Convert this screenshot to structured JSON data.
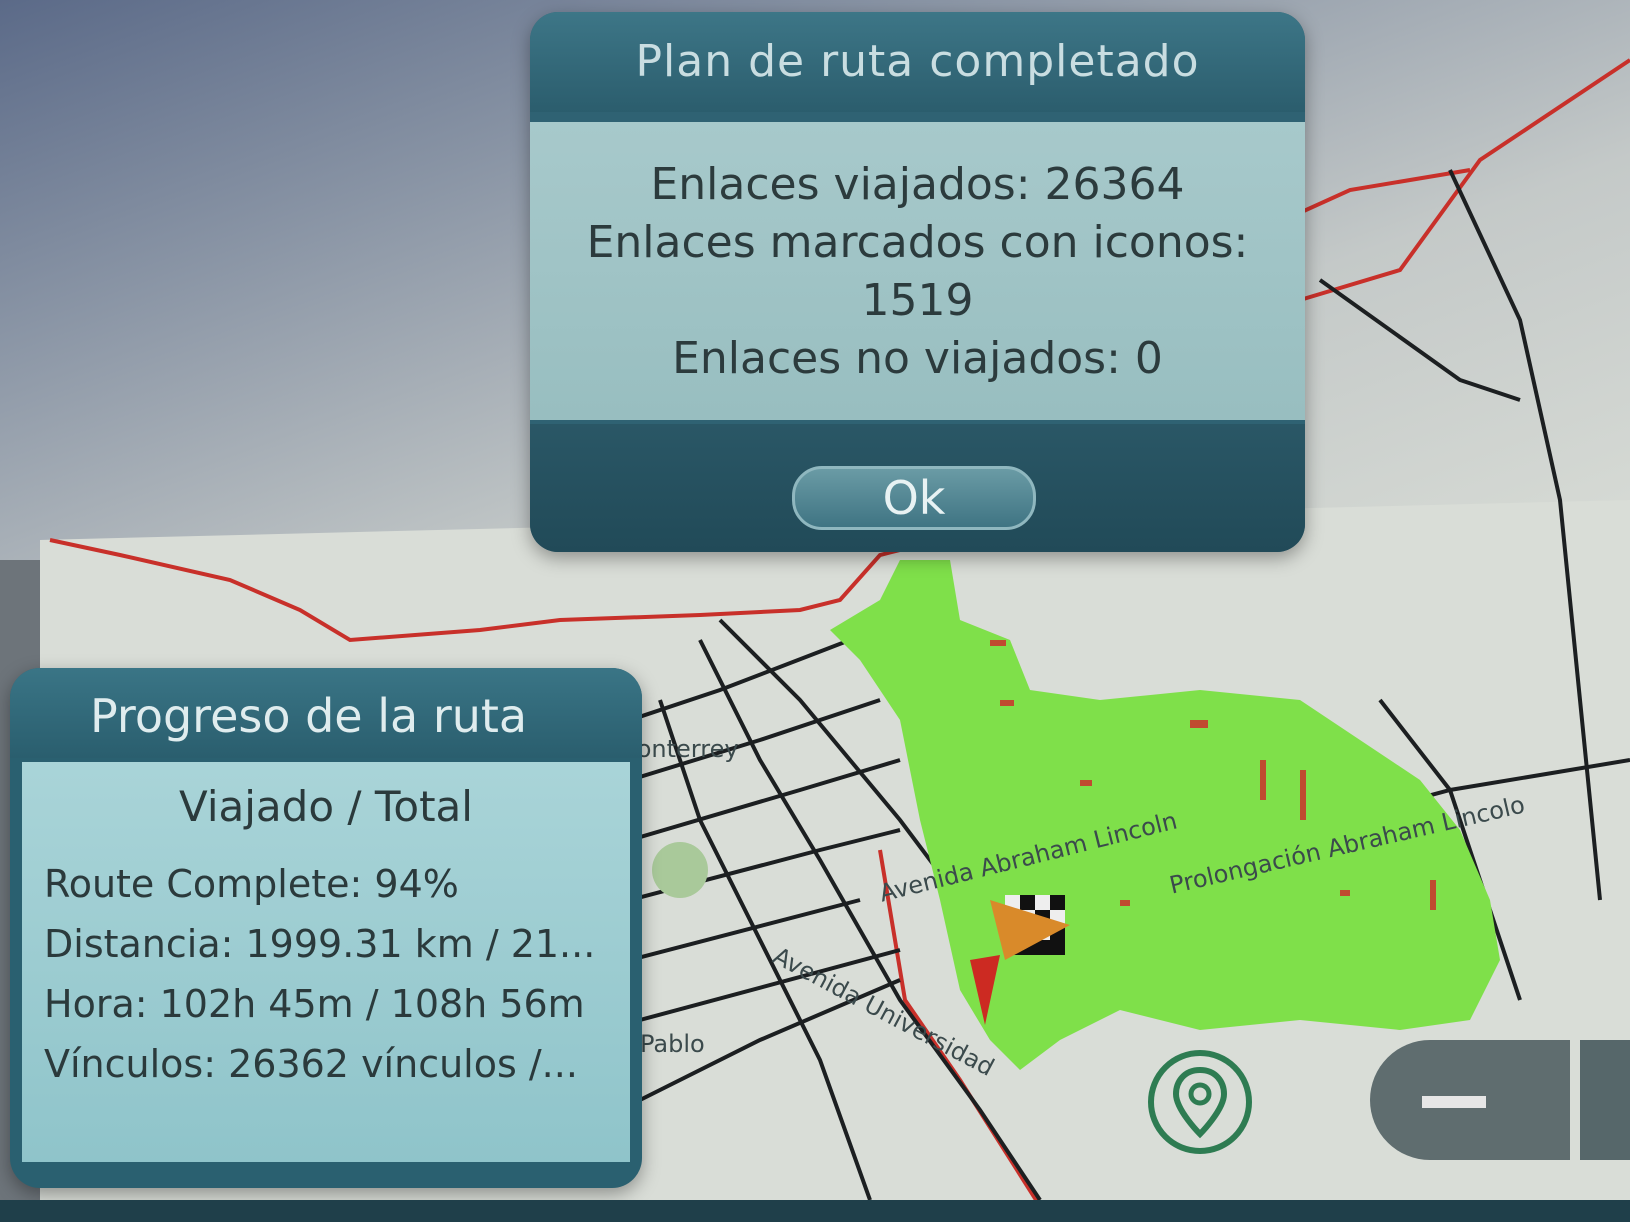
{
  "route_complete_dialog": {
    "title": "Plan de ruta completado",
    "lines": [
      "Enlaces viajados: 26364",
      "Enlaces marcados con iconos:",
      "1519",
      "Enlaces no viajados: 0"
    ],
    "ok_label": "Ok"
  },
  "progress_panel": {
    "title": "Progreso de la ruta",
    "header": "Viajado / Total",
    "route_complete": "Route Complete: 94%",
    "distance": "Distancia: 1999.31 km / 21...",
    "time": "Hora: 102h 45m / 108h 56m",
    "links": "Vínculos: 26362 vínculos /..."
  },
  "map": {
    "labels": {
      "monterrey": "Monterrey",
      "avenida_abraham_lincoln": "Avenida Abraham Lincoln",
      "prolongacion_abraham_lincoln": "Prolongación Abraham Lincolo",
      "avenida_universidad": "Avenida Universidad",
      "pablo": "Pablo"
    },
    "colors": {
      "coverage": "#7fe04a",
      "road": "#1c1f21",
      "highway": "#c8302a",
      "dialog": "#2f6273"
    },
    "icons": [
      "finish-flag-icon",
      "orange-arrow-icon",
      "red-arrow-icon",
      "location-pin-icon",
      "minus-icon"
    ]
  }
}
